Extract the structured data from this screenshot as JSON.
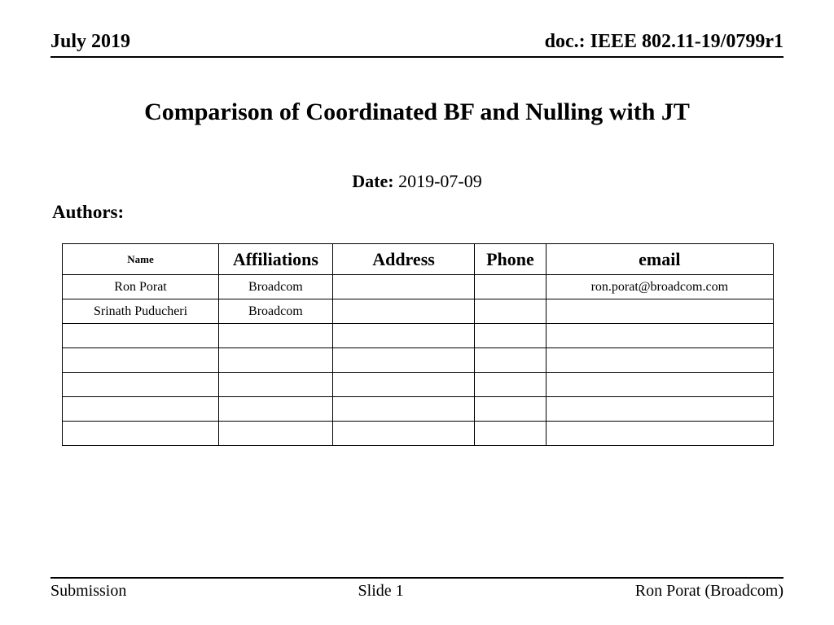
{
  "header": {
    "date_month": "July 2019",
    "doc_id": "doc.: IEEE 802.11-19/0799r1"
  },
  "title": "Comparison of Coordinated BF and Nulling with JT",
  "date_label": "Date:",
  "date_value": "2019-07-09",
  "authors_label": "Authors:",
  "table": {
    "headers": {
      "name": "Name",
      "affiliations": "Affiliations",
      "address": "Address",
      "phone": "Phone",
      "email": "email"
    },
    "rows": [
      {
        "name": "Ron Porat",
        "affiliations": "Broadcom",
        "address": "",
        "phone": "",
        "email": "ron.porat@broadcom.com"
      },
      {
        "name": "Srinath Puducheri",
        "affiliations": "Broadcom",
        "address": "",
        "phone": "",
        "email": ""
      },
      {
        "name": "",
        "affiliations": "",
        "address": "",
        "phone": "",
        "email": ""
      },
      {
        "name": "",
        "affiliations": "",
        "address": "",
        "phone": "",
        "email": ""
      },
      {
        "name": "",
        "affiliations": "",
        "address": "",
        "phone": "",
        "email": ""
      },
      {
        "name": "",
        "affiliations": "",
        "address": "",
        "phone": "",
        "email": ""
      },
      {
        "name": "",
        "affiliations": "",
        "address": "",
        "phone": "",
        "email": ""
      }
    ]
  },
  "footer": {
    "left": "Submission",
    "center": "Slide 1",
    "right": "Ron Porat (Broadcom)"
  }
}
